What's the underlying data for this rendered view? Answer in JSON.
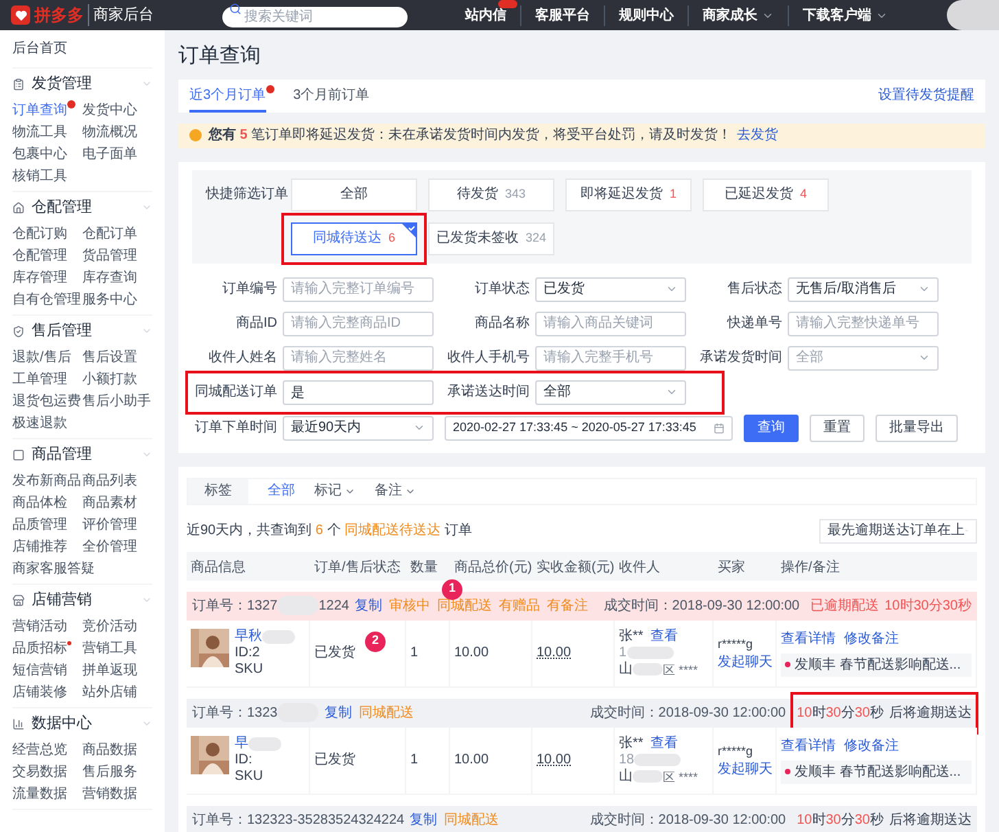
{
  "topbar": {
    "logo_text": "拼多多",
    "product": "商家后台",
    "search": {
      "placeholder": "搜索关键词"
    },
    "nav": [
      {
        "label": "站内信",
        "badge": true,
        "dropdown": false
      },
      {
        "label": "客服平台",
        "badge": false,
        "dropdown": false
      },
      {
        "label": "规则中心",
        "badge": false,
        "dropdown": false
      },
      {
        "label": "商家成长",
        "badge": false,
        "dropdown": true
      },
      {
        "label": "下载客户端",
        "badge": false,
        "dropdown": true
      }
    ]
  },
  "sidebar": {
    "home": "后台首页",
    "sections": [
      {
        "title": "发货管理",
        "items": [
          {
            "label": "订单查询",
            "selected": true,
            "badge": true,
            "dot": false
          },
          {
            "label": "发货中心",
            "selected": false,
            "badge": false,
            "dot": false
          },
          {
            "label": "物流工具",
            "selected": false,
            "badge": false,
            "dot": false
          },
          {
            "label": "物流概况",
            "selected": false,
            "badge": false,
            "dot": false
          },
          {
            "label": "包裹中心",
            "selected": false,
            "badge": false,
            "dot": false
          },
          {
            "label": "电子面单",
            "selected": false,
            "badge": false,
            "dot": false
          },
          {
            "label": "核销工具",
            "selected": false,
            "badge": false,
            "dot": false
          }
        ]
      },
      {
        "title": "仓配管理",
        "items": [
          {
            "label": "仓配订购",
            "selected": false,
            "badge": false,
            "dot": false
          },
          {
            "label": "仓配订单",
            "selected": false,
            "badge": false,
            "dot": false
          },
          {
            "label": "仓配管理",
            "selected": false,
            "badge": false,
            "dot": false
          },
          {
            "label": "货品管理",
            "selected": false,
            "badge": false,
            "dot": false
          },
          {
            "label": "库存管理",
            "selected": false,
            "badge": false,
            "dot": false
          },
          {
            "label": "库存查询",
            "selected": false,
            "badge": false,
            "dot": false
          },
          {
            "label": "自有仓管理",
            "selected": false,
            "badge": false,
            "dot": false
          },
          {
            "label": "服务中心",
            "selected": false,
            "badge": false,
            "dot": false
          }
        ]
      },
      {
        "title": "售后管理",
        "items": [
          {
            "label": "退款/售后",
            "selected": false,
            "badge": false,
            "dot": false
          },
          {
            "label": "售后设置",
            "selected": false,
            "badge": false,
            "dot": false
          },
          {
            "label": "工单管理",
            "selected": false,
            "badge": false,
            "dot": false
          },
          {
            "label": "小额打款",
            "selected": false,
            "badge": false,
            "dot": false
          },
          {
            "label": "退货包运费",
            "selected": false,
            "badge": false,
            "dot": false
          },
          {
            "label": "售后小助手",
            "selected": false,
            "badge": false,
            "dot": false
          },
          {
            "label": "极速退款",
            "selected": false,
            "badge": false,
            "dot": false
          }
        ]
      },
      {
        "title": "商品管理",
        "items": [
          {
            "label": "发布新商品",
            "selected": false,
            "badge": false,
            "dot": false
          },
          {
            "label": "商品列表",
            "selected": false,
            "badge": false,
            "dot": false
          },
          {
            "label": "商品体检",
            "selected": false,
            "badge": false,
            "dot": false
          },
          {
            "label": "商品素材",
            "selected": false,
            "badge": false,
            "dot": false
          },
          {
            "label": "品质管理",
            "selected": false,
            "badge": false,
            "dot": false
          },
          {
            "label": "评价管理",
            "selected": false,
            "badge": false,
            "dot": false
          },
          {
            "label": "店铺推荐",
            "selected": false,
            "badge": false,
            "dot": false
          },
          {
            "label": "全价管理",
            "selected": false,
            "badge": false,
            "dot": false
          },
          {
            "label": "商家客服答疑",
            "selected": false,
            "badge": false,
            "dot": false
          }
        ]
      },
      {
        "title": "店铺营销",
        "items": [
          {
            "label": "营销活动",
            "selected": false,
            "badge": false,
            "dot": false
          },
          {
            "label": "竞价活动",
            "selected": false,
            "badge": false,
            "dot": false
          },
          {
            "label": "品质招标",
            "selected": false,
            "badge": false,
            "dot": true
          },
          {
            "label": "营销工具",
            "selected": false,
            "badge": false,
            "dot": false
          },
          {
            "label": "短信营销",
            "selected": false,
            "badge": false,
            "dot": false
          },
          {
            "label": "拼单返现",
            "selected": false,
            "badge": false,
            "dot": false
          },
          {
            "label": "店铺装修",
            "selected": false,
            "badge": false,
            "dot": false
          },
          {
            "label": "站外店铺",
            "selected": false,
            "badge": false,
            "dot": false
          }
        ]
      },
      {
        "title": "数据中心",
        "items": [
          {
            "label": "经营总览",
            "selected": false,
            "badge": false,
            "dot": false
          },
          {
            "label": "商品数据",
            "selected": false,
            "badge": false,
            "dot": false
          },
          {
            "label": "交易数据",
            "selected": false,
            "badge": false,
            "dot": false
          },
          {
            "label": "售后服务",
            "selected": false,
            "badge": false,
            "dot": false
          },
          {
            "label": "流量数据",
            "selected": false,
            "badge": false,
            "dot": false
          },
          {
            "label": "营销数据",
            "selected": false,
            "badge": false,
            "dot": false
          }
        ]
      }
    ]
  },
  "page_title": "订单查询",
  "tabs": [
    {
      "label": "近3个月订单",
      "selected": true,
      "badge": true
    },
    {
      "label": "3个月前订单",
      "selected": false,
      "badge": false
    }
  ],
  "reminder_link": "设置待发货提醒",
  "warning": {
    "prefix": "您有",
    "count": "5",
    "message": "笔订单即将延迟发货：未在承诺发货时间内发货，将受平台处罚，请及时发货！",
    "link": "去发货"
  },
  "quick_filter": {
    "label": "快捷筛选订单",
    "options": [
      {
        "label": "全部",
        "selected": false,
        "annotated": false
      },
      {
        "label": "待发货",
        "count": "343",
        "alert": false,
        "selected": false,
        "annotated": false
      },
      {
        "label": "即将延迟发货",
        "count": "1",
        "alert": true,
        "selected": false,
        "annotated": false
      },
      {
        "label": "已延迟发货",
        "count": "4",
        "alert": true,
        "selected": false,
        "annotated": false
      },
      {
        "label": "同城待送达",
        "count": "6",
        "alert": true,
        "selected": true,
        "annotated": true
      },
      {
        "label": "已发货未签收",
        "count": "324",
        "alert": false,
        "selected": false,
        "annotated": false
      }
    ]
  },
  "form": {
    "rows": [
      {
        "annotated": false,
        "fields": [
          {
            "label": "订单编号",
            "kind": "text",
            "placeholder": "请输入完整订单编号"
          },
          {
            "label": "订单状态",
            "kind": "select",
            "value": "已发货"
          },
          {
            "label": "售后状态",
            "kind": "select",
            "value": "无售后/取消售后"
          }
        ]
      },
      {
        "annotated": false,
        "fields": [
          {
            "label": "商品ID",
            "kind": "text",
            "placeholder": "请输入完整商品ID"
          },
          {
            "label": "商品名称",
            "kind": "text",
            "placeholder": "请输入商品关键词"
          },
          {
            "label": "快递单号",
            "kind": "text",
            "placeholder": "请输入完整快递单号"
          }
        ]
      },
      {
        "annotated": false,
        "fields": [
          {
            "label": "收件人姓名",
            "kind": "text",
            "placeholder": "请输入完整姓名"
          },
          {
            "label": "收件人手机号",
            "kind": "text",
            "placeholder": "请输入完整手机号"
          },
          {
            "label": "承诺发货时间",
            "kind": "select",
            "placeholder": "全部"
          }
        ]
      },
      {
        "annotated": true,
        "fields": [
          {
            "label": "同城配送订单",
            "kind": "text",
            "value": "是"
          },
          {
            "label": "承诺送达时间",
            "kind": "select",
            "value": "全部"
          }
        ]
      }
    ],
    "date_row": {
      "label": "订单下单时间",
      "range": "最近90天内",
      "dates": "2020-02-27 17:33:45 ~ 2020-05-27 17:33:45"
    },
    "buttons": [
      {
        "label": "查询",
        "primary": true
      },
      {
        "label": "重置",
        "primary": false
      },
      {
        "label": "批量导出",
        "primary": false
      }
    ]
  },
  "tag_bar": {
    "label": "标签",
    "options": [
      {
        "label": "全部",
        "selected": true,
        "dropdown": false
      },
      {
        "label": "标记",
        "selected": false,
        "dropdown": true
      },
      {
        "label": "备注",
        "selected": false,
        "dropdown": true
      }
    ]
  },
  "summary": {
    "prefix": "近90天内，共查询到",
    "count": "6",
    "mid": "个",
    "tag": "同城配送待送达",
    "suffix": "订单"
  },
  "sort": {
    "value": "最先逾期送达订单在上"
  },
  "table": {
    "columns": [
      "商品信息",
      "订单/售后状态",
      "数量",
      "商品总价(元)",
      "实收金额(元)",
      "收件人",
      "买家",
      "操作/备注"
    ],
    "orders": [
      {
        "number": "订单号：1327",
        "redacted": true,
        "number_end": "1224",
        "copy": "复制",
        "marker": "1",
        "highlight": true,
        "tags": [
          "审核中",
          "同城配送",
          "有赠品",
          "有备注"
        ],
        "time": "成交时间：2018-09-30 12:00:00",
        "deadline": {
          "kind": "overdue",
          "label": "已逾期配送",
          "annotated": false,
          "parts": [
            {
              "text": "10",
              "kind": "num"
            },
            {
              "text": "时",
              "kind": "unit"
            },
            {
              "text": "30",
              "kind": "num"
            },
            {
              "text": "分",
              "kind": "unit"
            },
            {
              "text": "30",
              "kind": "num"
            },
            {
              "text": "秒",
              "kind": "unit"
            }
          ]
        },
        "item": {
          "title": "早秋",
          "id": "ID:2",
          "sku": "SKU",
          "status": "已发货",
          "marker": "2",
          "qty": "1",
          "total": "10.00",
          "received": "10.00",
          "recipient": {
            "name": "张**",
            "view": "查看",
            "phone": "1",
            "address": "山",
            "address_end": "区 ****"
          },
          "buyer": {
            "name": "r*****g",
            "chat": "发起聊天"
          },
          "actions": [
            "查看详情",
            "修改备注"
          ],
          "note": "发顺丰 春节配送影响配送..."
        }
      },
      {
        "number": "订单号：1323",
        "redacted": true,
        "copy": "复制",
        "highlight": false,
        "tags": [
          "同城配送"
        ],
        "time": "成交时间：2018-09-30 12:00:00",
        "deadline": {
          "kind": "pending",
          "label": "后将逾期送达",
          "annotated": true,
          "parts": [
            {
              "text": "10",
              "kind": "num"
            },
            {
              "text": "时",
              "kind": "unit"
            },
            {
              "text": "30",
              "kind": "num"
            },
            {
              "text": "分",
              "kind": "unit"
            },
            {
              "text": "30",
              "kind": "num"
            },
            {
              "text": "秒",
              "kind": "unit"
            }
          ]
        },
        "item": {
          "title": "早",
          "id": "ID:",
          "sku": "SKU",
          "status": "已发货",
          "qty": "1",
          "total": "10.00",
          "received": "10.00",
          "recipient": {
            "name": "张**",
            "view": "查看",
            "phone": "18",
            "address": "山",
            "address_end": "区 ****"
          },
          "buyer": {
            "name": "r*****g",
            "chat": "发起聊天"
          },
          "actions": [
            "查看详情",
            "修改备注"
          ],
          "note": "发顺丰 春节配送影响配送..."
        }
      },
      {
        "number": "订单号：132323-35283524324224",
        "redacted": false,
        "copy": "复制",
        "highlight": false,
        "tags": [
          "同城配送"
        ],
        "time": "成交时间：2018-09-30 12:00:00",
        "deadline": {
          "kind": "pending",
          "label": "后将逾期送达",
          "annotated": false,
          "parts": [
            {
              "text": "10",
              "kind": "num"
            },
            {
              "text": "时",
              "kind": "unit"
            },
            {
              "text": "30",
              "kind": "num"
            },
            {
              "text": "分",
              "kind": "unit"
            },
            {
              "text": "30",
              "kind": "num"
            },
            {
              "text": "秒",
              "kind": "unit"
            }
          ]
        }
      }
    ]
  }
}
